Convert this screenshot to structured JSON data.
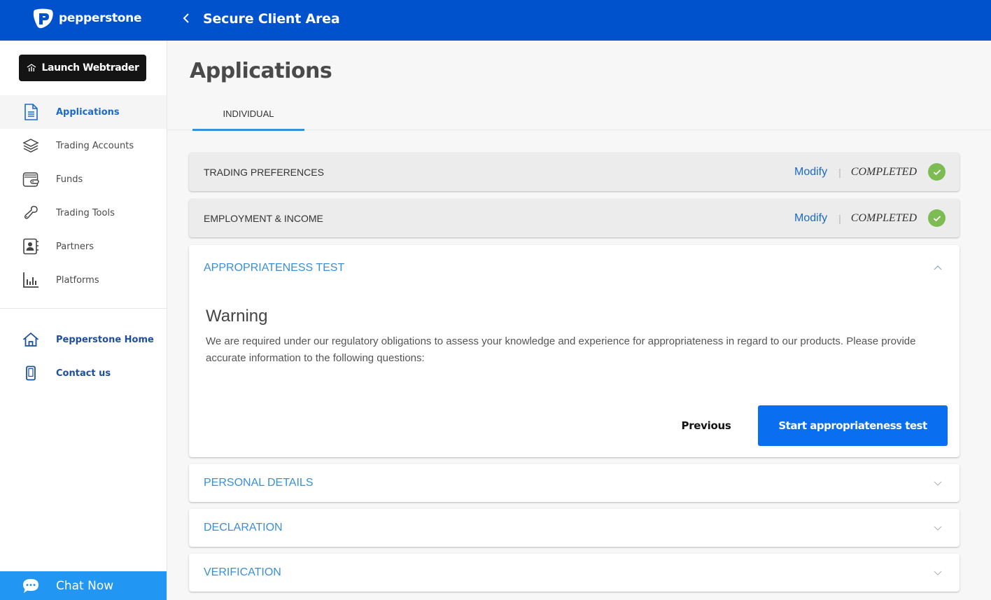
{
  "header": {
    "brand": "pepperstone",
    "title": "Secure Client Area",
    "back_icon": "chevron-left-icon",
    "brand_color": "#0052cc"
  },
  "sidebar": {
    "launch_button": "Launch Webtrader",
    "items": [
      {
        "label": "Applications",
        "icon": "document-icon",
        "active": true
      },
      {
        "label": "Trading Accounts",
        "icon": "layers-icon",
        "active": false
      },
      {
        "label": "Funds",
        "icon": "wallet-icon",
        "active": false
      },
      {
        "label": "Trading Tools",
        "icon": "wrench-icon",
        "active": false
      },
      {
        "label": "Partners",
        "icon": "contact-book-icon",
        "active": false
      },
      {
        "label": "Platforms",
        "icon": "bar-chart-icon",
        "active": false
      }
    ],
    "secondary_items": [
      {
        "label": "Pepperstone Home",
        "icon": "home-icon"
      },
      {
        "label": "Contact us",
        "icon": "mobile-phone-icon"
      }
    ],
    "chat": {
      "label": "Chat Now",
      "icon": "chat-bubble-icon"
    }
  },
  "main": {
    "page_title": "Applications",
    "tabs": [
      {
        "label": "INDIVIDUAL",
        "active": true
      }
    ],
    "sections": [
      {
        "title": "TRADING PREFERENCES",
        "state": "completed",
        "modify_label": "Modify",
        "status": "COMPLETED"
      },
      {
        "title": "EMPLOYMENT & INCOME",
        "state": "completed",
        "modify_label": "Modify",
        "status": "COMPLETED"
      },
      {
        "title": "APPROPRIATENESS TEST",
        "state": "expanded"
      },
      {
        "title": "PERSONAL DETAILS",
        "state": "collapsed"
      },
      {
        "title": "DECLARATION",
        "state": "collapsed"
      },
      {
        "title": "VERIFICATION",
        "state": "collapsed"
      }
    ],
    "appropriateness": {
      "warning_title": "Warning",
      "warning_text": "We are required under our regulatory obligations to assess your knowledge and experience for appropriateness in regard to our products. Please provide accurate information to the following questions:",
      "previous_label": "Previous",
      "start_label": "Start appropriateness test"
    }
  },
  "colors": {
    "accent_blue": "#0a6ef0",
    "section_blue": "#3b8fd6",
    "completed_green": "#7cbc52",
    "chat_blue": "#2196f3"
  }
}
